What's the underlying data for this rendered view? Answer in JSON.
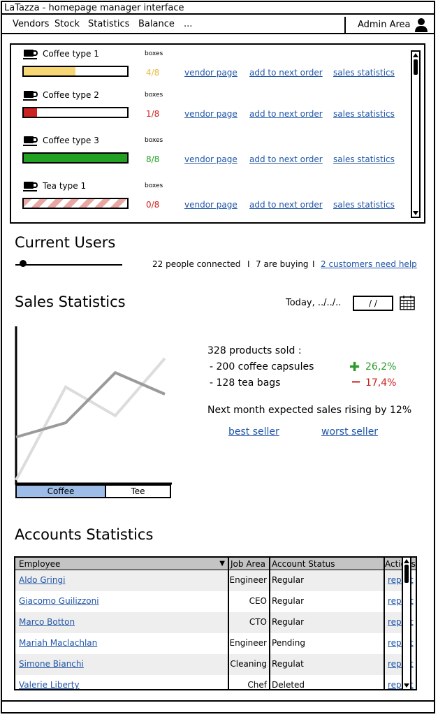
{
  "window": {
    "title": "LaTazza - homepage manager interface"
  },
  "menu": {
    "items": [
      "Vendors",
      "Stock",
      "Statistics",
      "Balance",
      "..."
    ],
    "admin_label": "Admin Area"
  },
  "stock": {
    "boxes_label": "boxes",
    "link_vendor": "vendor page",
    "link_order": "add to next order",
    "link_stats": "sales statistics",
    "items": [
      {
        "name": "Coffee type 1",
        "qty": "4/8",
        "level": 0.5,
        "color": "#f7d774",
        "qty_color": "#e8b93b",
        "pattern": "solid"
      },
      {
        "name": "Coffee type 2",
        "qty": "1/8",
        "level": 0.125,
        "color": "#cc2222",
        "qty_color": "#cc2222",
        "pattern": "solid"
      },
      {
        "name": "Coffee type 3",
        "qty": "8/8",
        "level": 1.0,
        "color": "#22a022",
        "qty_color": "#22a022",
        "pattern": "solid"
      },
      {
        "name": "Tea type 1",
        "qty": "0/8",
        "level": 0,
        "color": "#e8a7a3",
        "qty_color": "#cc2222",
        "pattern": "striped"
      }
    ]
  },
  "users": {
    "title": "Current Users",
    "connected": "22 people connected",
    "sep": "I",
    "buying": "7 are buying",
    "help_link": "2 customers need help"
  },
  "sales": {
    "title": "Sales Statistics",
    "date_label": "Today, ../../..",
    "date_value": "/ /",
    "summary": "328 products sold :",
    "coffee_line": "- 200 coffee capsules",
    "coffee_pct": "26,2%",
    "tea_line": "- 128 tea bags",
    "tea_pct": "17,4%",
    "forecast": "Next month expected sales rising by 12%",
    "best_link": "best seller",
    "worst_link": "worst seller",
    "legend": {
      "coffee": "Coffee",
      "tea": "Tee"
    }
  },
  "chart_data": {
    "type": "line",
    "title": "",
    "xlabel": "",
    "ylabel": "",
    "x": [
      0,
      1,
      2,
      3
    ],
    "series": [
      {
        "name": "Coffee",
        "values": [
          0.3,
          0.4,
          0.75,
          0.6
        ]
      },
      {
        "name": "Tee",
        "values": [
          0.0,
          0.65,
          0.45,
          0.85
        ]
      }
    ],
    "ylim": [
      0,
      1
    ],
    "grid": false
  },
  "accounts": {
    "title": "Accounts Statistics",
    "columns": [
      "Employee",
      "Job Area",
      "Account Status",
      "Actions"
    ],
    "rows": [
      {
        "employee": "Aldo Gringi",
        "job": "Engineer",
        "status": "Regular",
        "action": "report"
      },
      {
        "employee": "Giacomo Guilizzoni",
        "job": "CEO",
        "status": "Regular",
        "action": "report"
      },
      {
        "employee": "Marco Botton",
        "job": "CTO",
        "status": "Regular",
        "action": "report"
      },
      {
        "employee": "Mariah Maclachlan",
        "job": "Engineer",
        "status": "Pending",
        "action": "report"
      },
      {
        "employee": "Simone Bianchi",
        "job": "Cleaning",
        "status": "Regulat",
        "action": "report"
      },
      {
        "employee": "Valerie Liberty",
        "job": "Chef",
        "status": "Deleted",
        "action": "report"
      }
    ]
  }
}
